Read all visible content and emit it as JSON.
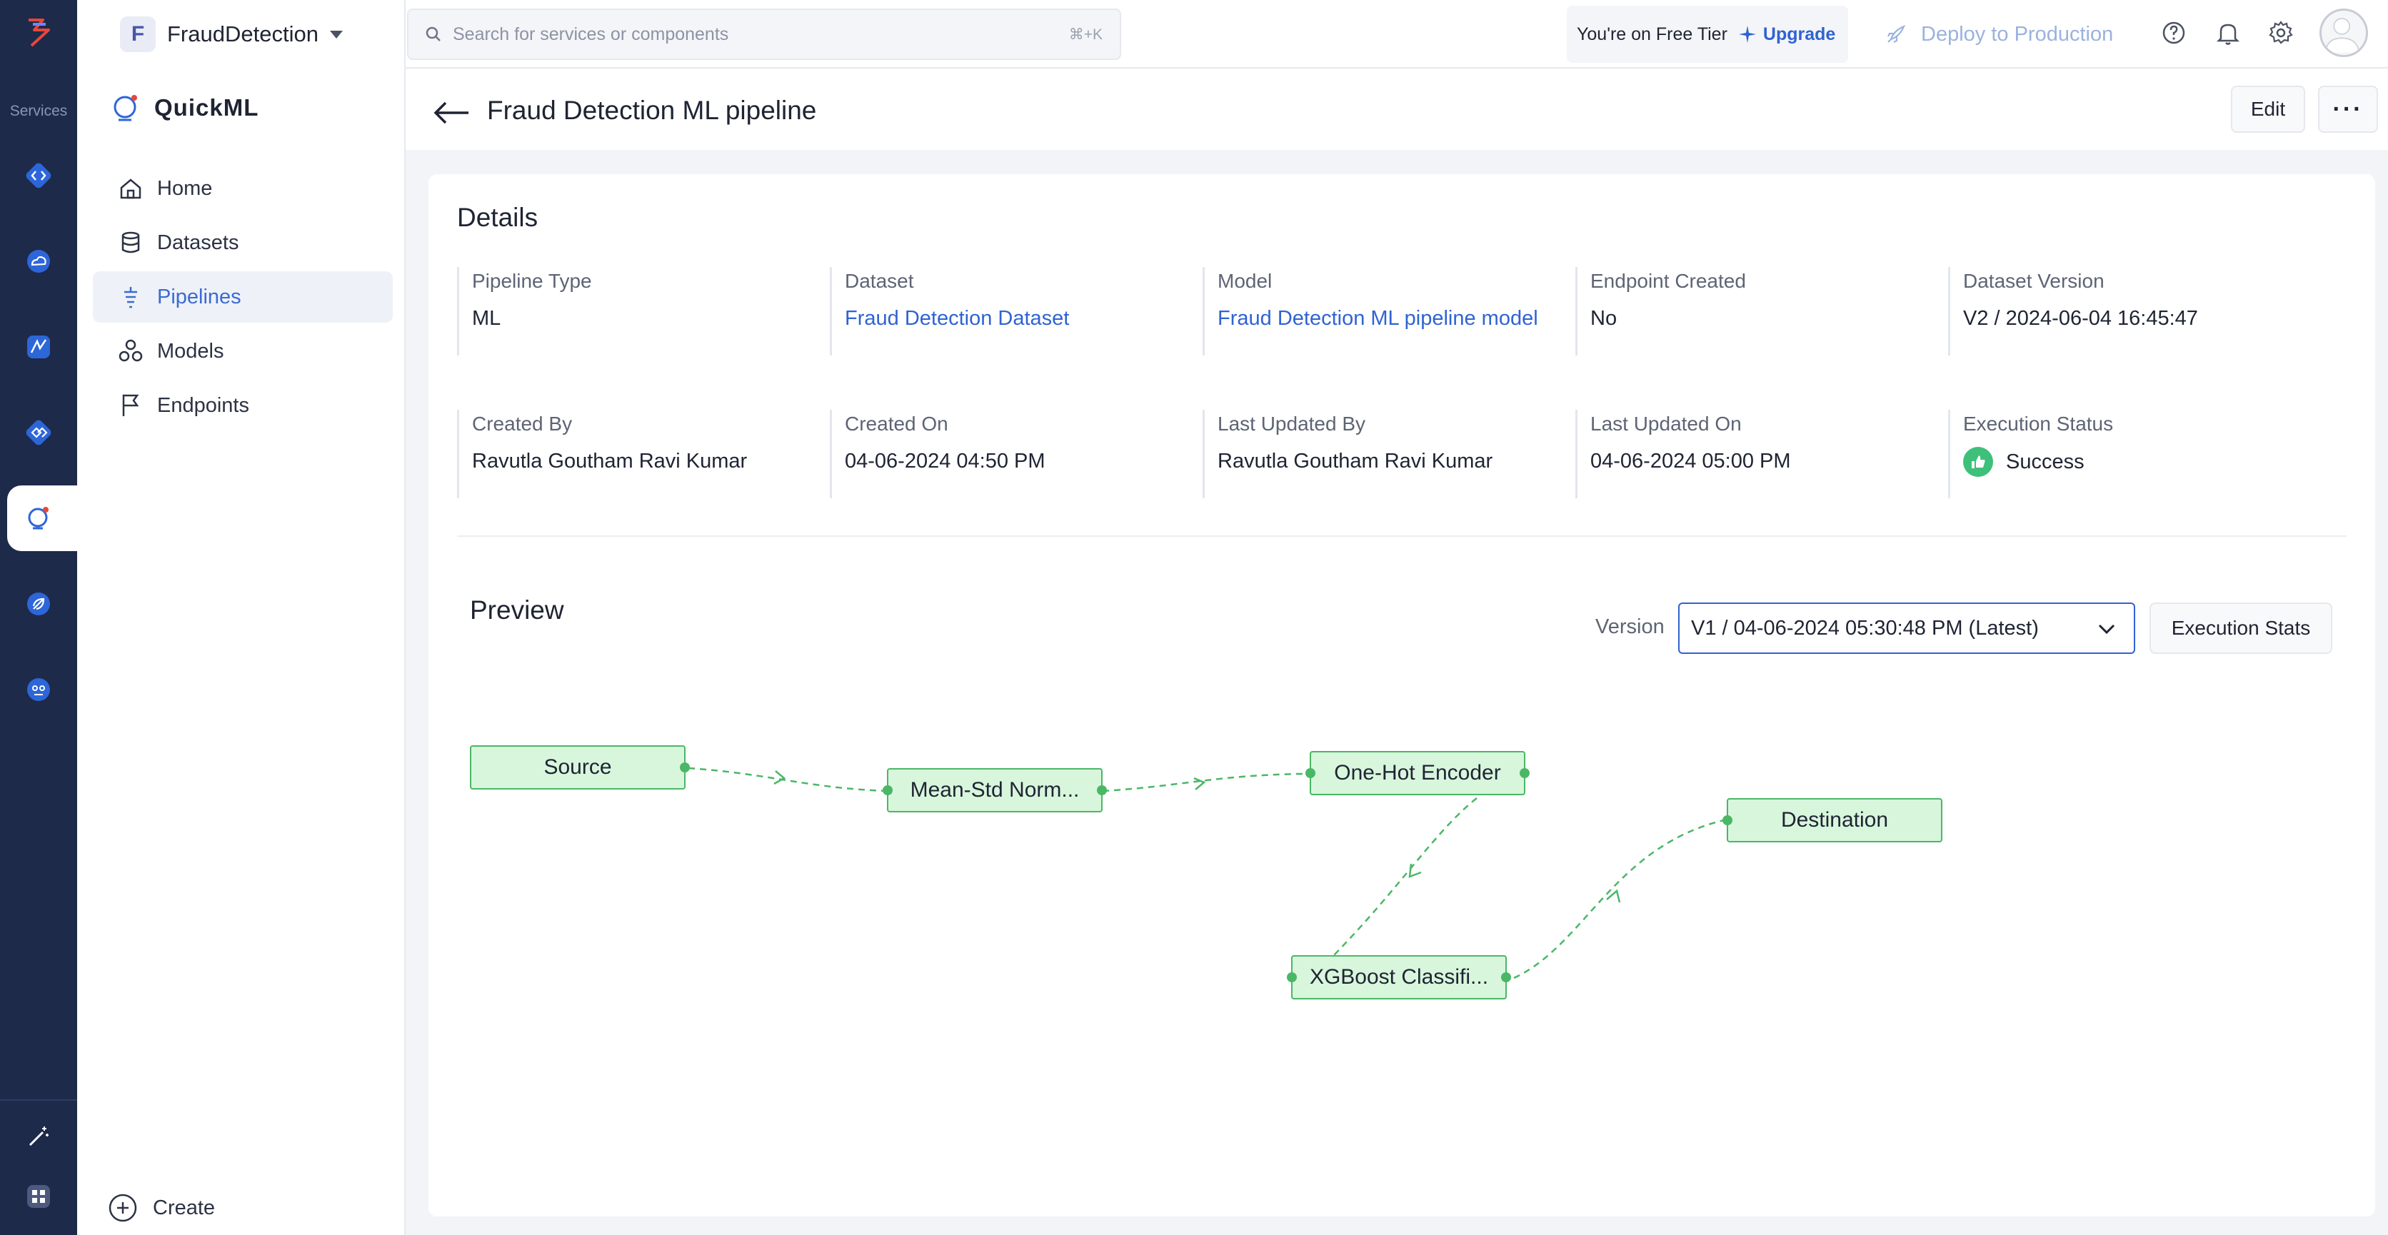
{
  "rail": {
    "label": "Services",
    "icons": [
      "code-service-icon",
      "cloud-service-icon",
      "analytics-service-icon",
      "integration-service-icon",
      "quickml-icon",
      "rocket-service-icon",
      "bot-service-icon",
      "magic-wand-icon",
      "apps-grid-icon"
    ]
  },
  "sidebar": {
    "project_initial": "F",
    "project_name": "FraudDetection",
    "app_title": "QuickML",
    "items": [
      {
        "label": "Home",
        "icon": "home-icon"
      },
      {
        "label": "Datasets",
        "icon": "database-icon"
      },
      {
        "label": "Pipelines",
        "icon": "pipeline-icon",
        "active": true
      },
      {
        "label": "Models",
        "icon": "models-icon"
      },
      {
        "label": "Endpoints",
        "icon": "flag-icon"
      }
    ],
    "create_label": "Create"
  },
  "topbar": {
    "search_placeholder": "Search for services or components",
    "search_shortcut": "⌘+K",
    "tier_text": "You're on Free Tier",
    "upgrade_label": "Upgrade",
    "deploy_label": "Deploy to Production"
  },
  "header": {
    "title": "Fraud Detection ML pipeline",
    "edit_label": "Edit",
    "more_label": "···"
  },
  "details": {
    "title": "Details",
    "fields": [
      {
        "label": "Pipeline Type",
        "value": "ML"
      },
      {
        "label": "Dataset",
        "value": "Fraud Detection Dataset"
      },
      {
        "label": "Model",
        "value": "Fraud Detection ML pipeline model"
      },
      {
        "label": "Endpoint Created",
        "value": "No"
      },
      {
        "label": "Dataset Version",
        "value": "V2 / 2024-06-04 16:45:47"
      },
      {
        "label": "Created By",
        "value": "Ravutla Goutham Ravi Kumar"
      },
      {
        "label": "Created On",
        "value": "04-06-2024 04:50 PM"
      },
      {
        "label": "Last Updated By",
        "value": "Ravutla Goutham Ravi Kumar"
      },
      {
        "label": "Last Updated On",
        "value": "04-06-2024 05:00 PM"
      },
      {
        "label": "Execution Status",
        "value": "Success"
      }
    ]
  },
  "preview": {
    "title": "Preview",
    "version_label": "Version",
    "version_value": "V1 / 04-06-2024 05:30:48 PM (Latest)",
    "exec_stats_label": "Execution Stats",
    "nodes": [
      {
        "label": "Source"
      },
      {
        "label": "Mean-Std Norm..."
      },
      {
        "label": "One-Hot Encoder"
      },
      {
        "label": "Destination"
      },
      {
        "label": "XGBoost Classifi..."
      }
    ]
  },
  "colors": {
    "rail": "#1d2a4a",
    "accent": "#2f63d2",
    "node_fill": "#d8f6dc",
    "node_border": "#4ab766",
    "success": "#3ec07a"
  }
}
